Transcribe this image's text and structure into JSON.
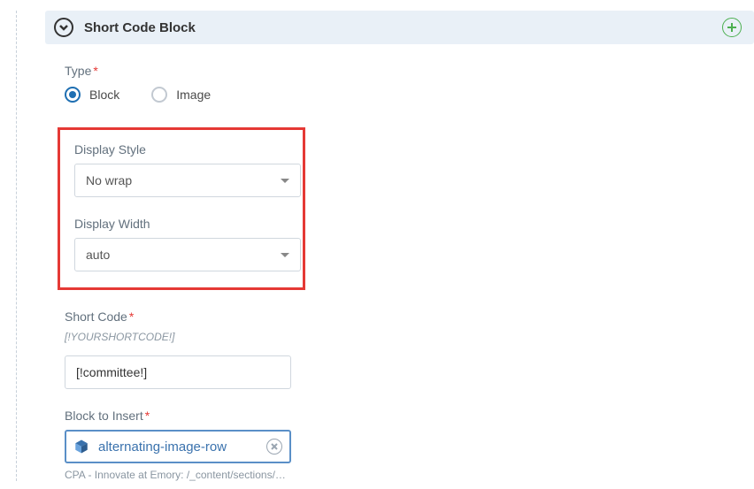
{
  "header": {
    "title": "Short Code Block"
  },
  "form": {
    "type": {
      "label": "Type",
      "options": {
        "block": "Block",
        "image": "Image"
      }
    },
    "displayStyle": {
      "label": "Display Style",
      "value": "No wrap"
    },
    "displayWidth": {
      "label": "Display Width",
      "value": "auto"
    },
    "shortCode": {
      "label": "Short Code",
      "hint": "[!YOURSHORTCODE!]",
      "value": "[!committee!]"
    },
    "blockToInsert": {
      "label": "Block to Insert",
      "chip": "alternating-image-row",
      "path": "CPA - Innovate at Emory: /_content/sections/…"
    }
  }
}
